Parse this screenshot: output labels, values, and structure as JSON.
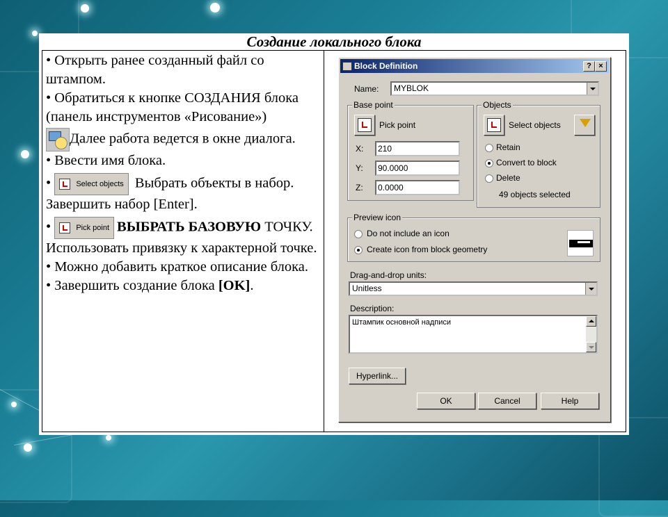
{
  "slide": {
    "title": "Создание локального блока",
    "bullets": {
      "b1": "• Открыть ранее созданный файл со штампом.",
      "b2": "• Обратиться к кнопке СОЗДАНИЯ блока (панель инструментов «Рисование»)",
      "b3": "Далее работа ведется в окне диалога.",
      "b4": "• Ввести имя блока.",
      "b5_btn": "Select objects",
      "b5_text": "Выбрать объекты в набор. Завершить набор [Enter].",
      "b6_btn": "Pick point",
      "b6_bold": "ВЫБРАТЬ БАЗОВУЮ",
      "b6_text": "ТОЧКУ. Использовать привязку к характерной точке.",
      "b7": "• Можно добавить краткое описание блока.",
      "b8_pre": "• Завершить создание блока ",
      "b8_ok": "[OK]",
      "b8_end": "."
    }
  },
  "dialog": {
    "title": "Block Definition",
    "help_btn": "?",
    "close_btn": "×",
    "name_label": "Name:",
    "name_value": "MYBLOK",
    "base_point": {
      "group_label": "Base point",
      "pick_label": "Pick point",
      "x_label": "X:",
      "x_value": "210",
      "y_label": "Y:",
      "y_value": "90.0000",
      "z_label": "Z:",
      "z_value": "0.0000"
    },
    "objects": {
      "group_label": "Objects",
      "select_label": "Select objects",
      "retain": "Retain",
      "convert": "Convert to block",
      "delete": "Delete",
      "status": "49 objects selected"
    },
    "preview": {
      "group_label": "Preview icon",
      "opt_none": "Do not include an icon",
      "opt_create": "Create icon from block geometry"
    },
    "units_label": "Drag-and-drop units:",
    "units_value": "Unitless",
    "description_label": "Description:",
    "description_value": "Штампик основной надписи",
    "hyperlink_btn": "Hyperlink...",
    "ok_btn": "OK",
    "cancel_btn": "Cancel",
    "help_label": "Help"
  }
}
